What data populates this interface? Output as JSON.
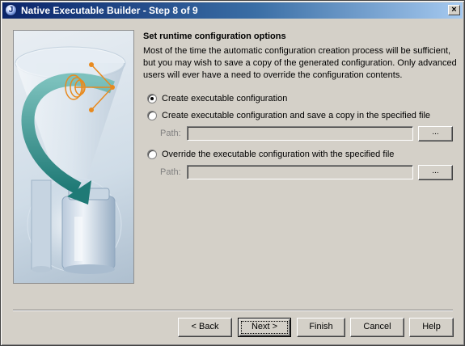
{
  "window": {
    "title": "Native Executable Builder - Step 8 of 9",
    "app_icon_glyph": "J",
    "close_glyph": "×"
  },
  "main": {
    "heading": "Set runtime configuration options",
    "description": "Most of the time the automatic configuration creation process will be sufficient, but you may wish to save a copy of the generated configuration. Only advanced users will ever have a need to override the configuration contents.",
    "options": [
      {
        "label": "Create executable configuration",
        "checked": true
      },
      {
        "label": "Create executable configuration and save a copy in the specified file",
        "checked": false
      },
      {
        "label": "Override the executable configuration with the specified file",
        "checked": false
      }
    ],
    "path_label": "Path:",
    "browse_label": "..."
  },
  "buttons": {
    "back": "< Back",
    "next": "Next >",
    "finish": "Finish",
    "cancel": "Cancel",
    "help": "Help"
  },
  "colors": {
    "title_start": "#0a246a",
    "title_end": "#a6caf0",
    "face": "#d4d0c8",
    "arrow": "#2e8a86",
    "orange": "#e88a1e"
  },
  "icons": {
    "app": "app-icon",
    "close": "close-icon",
    "illustration": "funnel-to-jar-illustration"
  }
}
